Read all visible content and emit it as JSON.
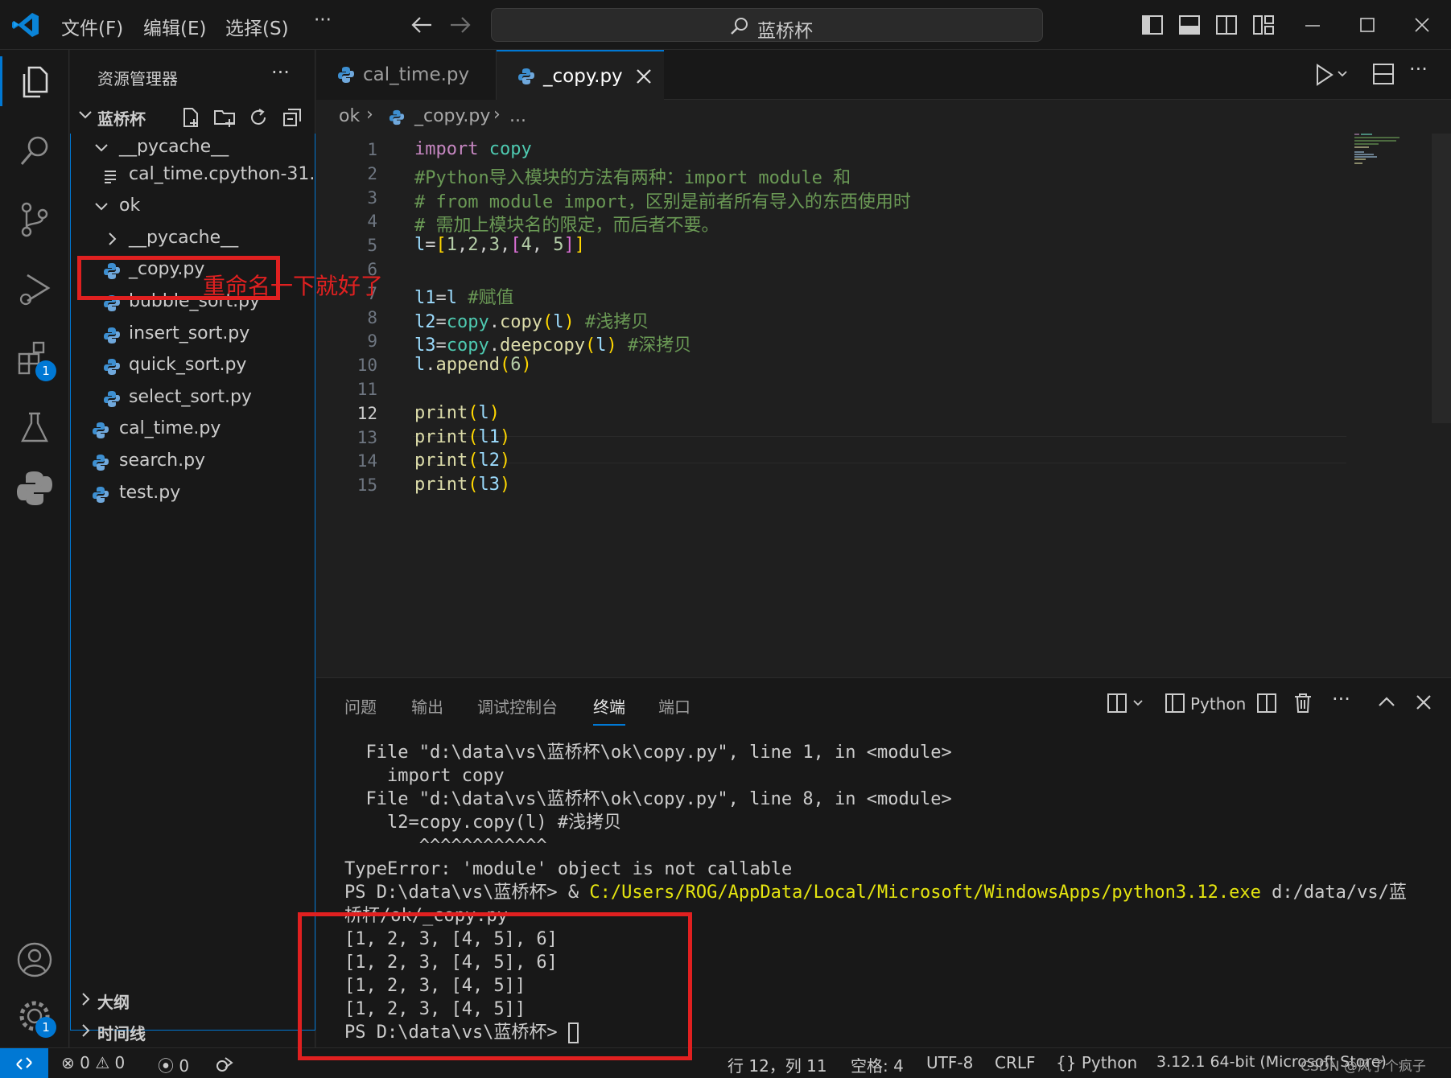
{
  "titlebar": {
    "menus": [
      "文件(F)",
      "编辑(E)",
      "选择(S)"
    ],
    "more": "···",
    "search_label": "蓝桥杯"
  },
  "activity": {
    "extensions_badge": "1",
    "settings_badge": "1"
  },
  "sidebar": {
    "title": "资源管理器",
    "more": "···",
    "folder": "蓝桥杯",
    "tree": [
      {
        "label": "__pycache__",
        "type": "folder-open",
        "indent": 1
      },
      {
        "label": "cal_time.cpython-31...",
        "type": "file-text",
        "indent": 2
      },
      {
        "label": "ok",
        "type": "folder-open",
        "indent": 1
      },
      {
        "label": "__pycache__",
        "type": "folder-closed",
        "indent": 2
      },
      {
        "label": "_copy.py",
        "type": "py",
        "indent": 2
      },
      {
        "label": "bubble_sort.py",
        "type": "py",
        "indent": 2
      },
      {
        "label": "insert_sort.py",
        "type": "py",
        "indent": 2
      },
      {
        "label": "quick_sort.py",
        "type": "py",
        "indent": 2
      },
      {
        "label": "select_sort.py",
        "type": "py",
        "indent": 2
      },
      {
        "label": "cal_time.py",
        "type": "py",
        "indent": 1
      },
      {
        "label": "search.py",
        "type": "py",
        "indent": 1
      },
      {
        "label": "test.py",
        "type": "py",
        "indent": 1
      }
    ],
    "outline": "大纲",
    "timeline": "时间线"
  },
  "tabs": [
    {
      "label": "cal_time.py",
      "active": false
    },
    {
      "label": "_copy.py",
      "active": true
    }
  ],
  "breadcrumb": {
    "folder": "ok",
    "file": "_copy.py",
    "tail": "..."
  },
  "editor": {
    "current_line": 12,
    "lines": [
      [
        {
          "t": "import",
          "c": "kw"
        },
        {
          "t": " "
        },
        {
          "t": "copy",
          "c": "mod"
        }
      ],
      [
        {
          "t": "#Python导入模块的方法有两种：import module 和",
          "c": "cm"
        }
      ],
      [
        {
          "t": "# from module import，区别是前者所有导入的东西使用时",
          "c": "cm"
        }
      ],
      [
        {
          "t": "# 需加上模块名的限定，而后者不要。",
          "c": "cm"
        }
      ],
      [
        {
          "t": "l",
          "c": "var"
        },
        {
          "t": "="
        },
        {
          "t": "[",
          "c": "br1"
        },
        {
          "t": "1",
          "c": "num"
        },
        {
          "t": ","
        },
        {
          "t": "2",
          "c": "num"
        },
        {
          "t": ","
        },
        {
          "t": "3",
          "c": "num"
        },
        {
          "t": ","
        },
        {
          "t": "[",
          "c": "br2"
        },
        {
          "t": "4",
          "c": "num"
        },
        {
          "t": ", "
        },
        {
          "t": "5",
          "c": "num"
        },
        {
          "t": "]",
          "c": "br2"
        },
        {
          "t": "]",
          "c": "br1"
        }
      ],
      [],
      [
        {
          "t": "l1",
          "c": "var"
        },
        {
          "t": "="
        },
        {
          "t": "l",
          "c": "var"
        },
        {
          "t": " "
        },
        {
          "t": "#赋值",
          "c": "cm"
        }
      ],
      [
        {
          "t": "l2",
          "c": "var"
        },
        {
          "t": "="
        },
        {
          "t": "copy",
          "c": "mod"
        },
        {
          "t": "."
        },
        {
          "t": "copy",
          "c": "fn"
        },
        {
          "t": "(",
          "c": "br1"
        },
        {
          "t": "l",
          "c": "var"
        },
        {
          "t": ")",
          "c": "br1"
        },
        {
          "t": " "
        },
        {
          "t": "#浅拷贝",
          "c": "cm"
        }
      ],
      [
        {
          "t": "l3",
          "c": "var"
        },
        {
          "t": "="
        },
        {
          "t": "copy",
          "c": "mod"
        },
        {
          "t": "."
        },
        {
          "t": "deepcopy",
          "c": "fn"
        },
        {
          "t": "(",
          "c": "br1"
        },
        {
          "t": "l",
          "c": "var"
        },
        {
          "t": ")",
          "c": "br1"
        },
        {
          "t": " "
        },
        {
          "t": "#深拷贝",
          "c": "cm"
        }
      ],
      [
        {
          "t": "l",
          "c": "var"
        },
        {
          "t": "."
        },
        {
          "t": "append",
          "c": "fn"
        },
        {
          "t": "(",
          "c": "br1"
        },
        {
          "t": "6",
          "c": "num"
        },
        {
          "t": ")",
          "c": "br1"
        }
      ],
      [],
      [
        {
          "t": "print",
          "c": "fn"
        },
        {
          "t": "(",
          "c": "br1"
        },
        {
          "t": "l",
          "c": "var"
        },
        {
          "t": ")",
          "c": "br1"
        }
      ],
      [
        {
          "t": "print",
          "c": "fn"
        },
        {
          "t": "(",
          "c": "br1"
        },
        {
          "t": "l1",
          "c": "var"
        },
        {
          "t": ")",
          "c": "br1"
        }
      ],
      [
        {
          "t": "print",
          "c": "fn"
        },
        {
          "t": "(",
          "c": "br1"
        },
        {
          "t": "l2",
          "c": "var"
        },
        {
          "t": ")",
          "c": "br1"
        }
      ],
      [
        {
          "t": "print",
          "c": "fn"
        },
        {
          "t": "(",
          "c": "br1"
        },
        {
          "t": "l3",
          "c": "var"
        },
        {
          "t": ")",
          "c": "br1"
        }
      ]
    ]
  },
  "panel": {
    "tabs": [
      "问题",
      "输出",
      "调试控制台",
      "终端",
      "端口"
    ],
    "active_tab": "终端",
    "terminal_profile": "Python",
    "terminal_lines": [
      "  File \"d:\\data\\vs\\蓝桥杯\\ok\\copy.py\", line 1, in <module>",
      "    import copy",
      "  File \"d:\\data\\vs\\蓝桥杯\\ok\\copy.py\", line 8, in <module>",
      "    l2=copy.copy(l) #浅拷贝",
      "       ^^^^^^^^^^^^",
      "TypeError: 'module' object is not callable"
    ],
    "cmd_prompt": "PS D:\\data\\vs\\蓝桥杯> & ",
    "cmd_exe": "C:/Users/ROG/AppData/Local/Microsoft/WindowsApps/python3.12.exe",
    "cmd_arg": " d:/data/vs/蓝",
    "cmd_wrap": "桥杯/ok/_copy.py",
    "output_lines": [
      "[1, 2, 3, [4, 5], 6]",
      "[1, 2, 3, [4, 5], 6]",
      "[1, 2, 3, [4, 5]]",
      "[1, 2, 3, [4, 5]]"
    ],
    "final_prompt": "PS D:\\data\\vs\\蓝桥杯> "
  },
  "statusbar": {
    "errors": "0",
    "warnings": "0",
    "ports": "0",
    "position": "行 12，列 11",
    "spaces": "空格: 4",
    "encoding": "UTF-8",
    "eol": "CRLF",
    "language": "Python",
    "interpreter": "3.12.1 64-bit (Microsoft Store)",
    "watermark": "CSDN @风了个疯子"
  },
  "annotation": {
    "text": "重命名一下就好了",
    "color": "#e02020"
  },
  "colors": {
    "accent": "#0078d4",
    "background": "#1f1f1f",
    "sidebar": "#181818"
  }
}
